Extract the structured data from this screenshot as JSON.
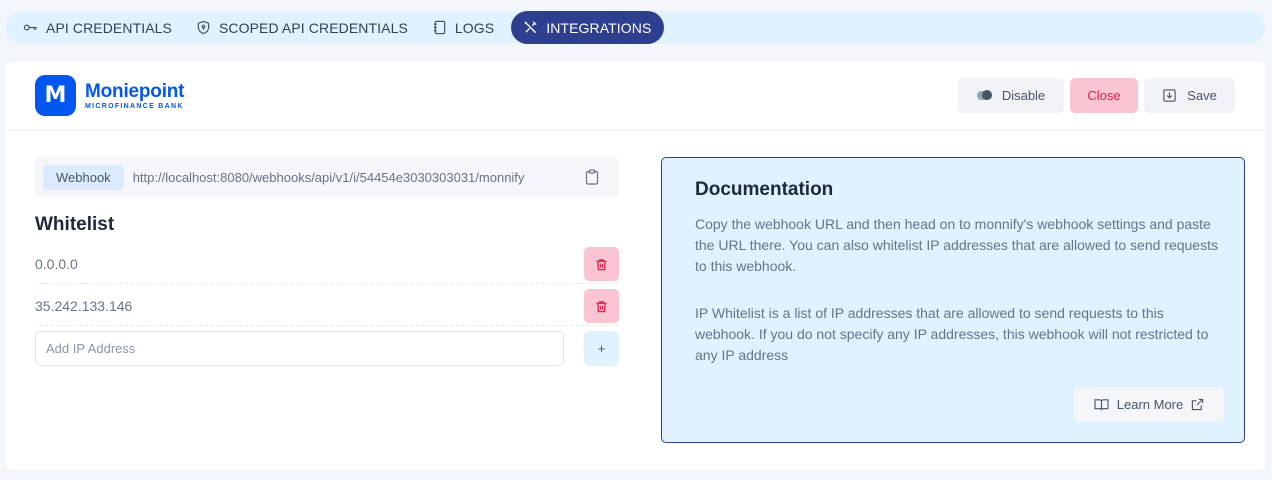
{
  "tabs": [
    {
      "label": "API CREDENTIALS",
      "icon": "key-icon",
      "active": false
    },
    {
      "label": "SCOPED API CREDENTIALS",
      "icon": "shield-icon",
      "active": false
    },
    {
      "label": "LOGS",
      "icon": "notebook-icon",
      "active": false
    },
    {
      "label": "INTEGRATIONS",
      "icon": "tools-icon",
      "active": true
    }
  ],
  "brand": {
    "logo_letter": "M",
    "name": "Moniepoint",
    "subtitle": "MICROFINANCE BANK",
    "color": "#0357ee"
  },
  "actions": {
    "disable_label": "Disable",
    "close_label": "Close",
    "save_label": "Save"
  },
  "webhook": {
    "tag": "Webhook",
    "url": "http://localhost:8080/webhooks/api/v1/i/54454e3030303031/monnify"
  },
  "whitelist": {
    "title": "Whitelist",
    "ips": [
      "0.0.0.0",
      "35.242.133.146"
    ],
    "add_placeholder": "Add IP Address",
    "add_label": "+"
  },
  "documentation": {
    "title": "Documentation",
    "paragraph1": "Copy the webhook URL and then head on to monnify's webhook settings and paste the URL there. You can also whitelist IP addresses that are allowed to send requests to this webhook.",
    "paragraph2": "IP Whitelist is a list of IP addresses that are allowed to send requests to this webhook. If you do not specify any IP addresses, this webhook will not restricted to any IP address",
    "learn_more_label": "Learn More"
  },
  "colors": {
    "accent": "#2e3f8f",
    "danger_bg": "#fbc4d3",
    "danger_text": "#e11d48",
    "info_bg": "#e0f2fe"
  }
}
